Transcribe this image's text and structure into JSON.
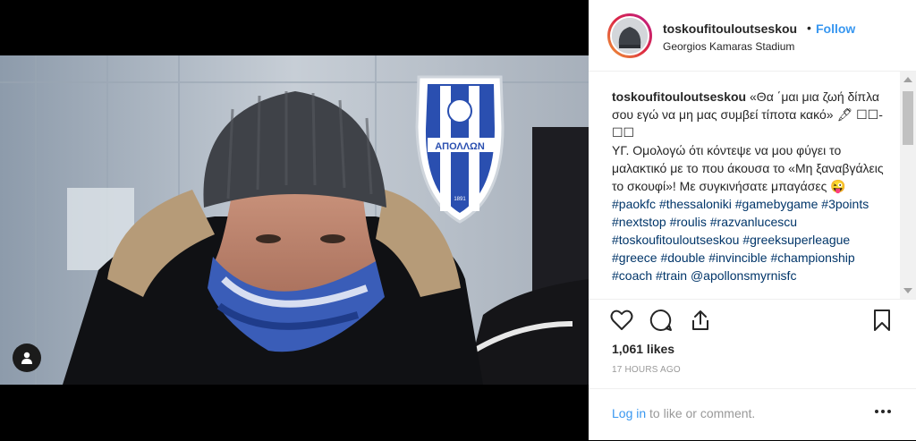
{
  "post": {
    "username": "toskoufitouloutseskou",
    "separator": "•",
    "follow_label": "Follow",
    "location": "Georgios Kamaras Stadium",
    "caption_username": "toskoufitouloutseskou",
    "caption_text_1": "«Θα ΄μαι μια ζωή δίπλα σου εγώ να μη μας συμβεί τίποτα κακό» 🖋 ☐☐-☐☐",
    "caption_text_2": "ΥΓ. Ομολογώ ότι κόντεψε να μου φύγει το μαλακτικό με το που άκουσα το «Μη ξαναβγάλεις το σκουφί»! Με συγκινήσατε μπαγάσες 😜",
    "hashtags": [
      "#paokfc",
      "#thessaloniki",
      "#gamebygame",
      "#3points",
      "#nextstop",
      "#roulis",
      "#razvanlucescu",
      "#toskoufitouloutseskou",
      "#greeksuperleague",
      "#greece",
      "#double",
      "#invincible",
      "#championship",
      "#coach",
      "#train",
      "@apollonsmyrnisfc"
    ],
    "likes": "1,061 likes",
    "time_ago": "17 HOURS AGO",
    "login_link": "Log in",
    "login_rest": " to like or comment.",
    "photo_sign": "ΑΠΟΛΛΩΝ",
    "photo_sign_year": "1891"
  },
  "icons": {
    "user_tag": "person-icon",
    "like": "heart-icon",
    "comment": "comment-icon",
    "share": "share-icon",
    "save": "bookmark-icon",
    "more": "more-dots-icon"
  },
  "colors": {
    "accent": "#3897f0",
    "tag": "#003569",
    "text": "#262626",
    "muted": "#999999"
  }
}
